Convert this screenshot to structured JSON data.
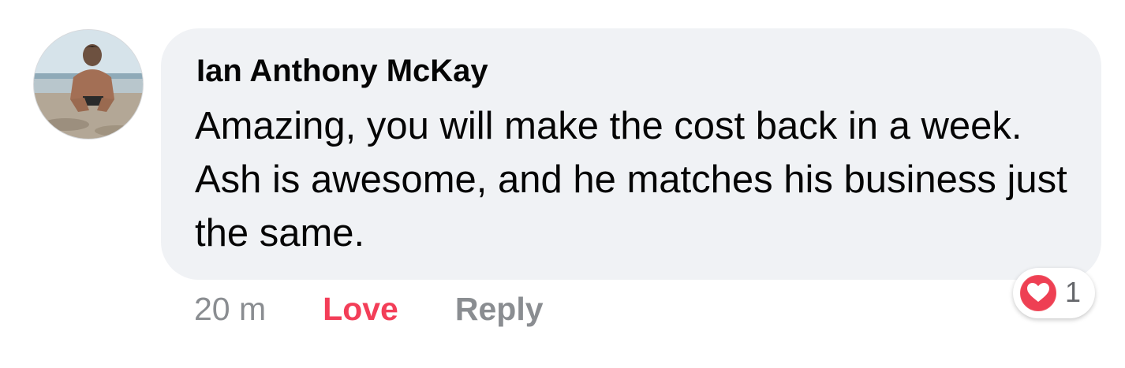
{
  "comment": {
    "author": "Ian Anthony McKay",
    "text": "Amazing, you will make the cost back in a week. Ash is awesome, and he matches his business just the same.",
    "timestamp": "20 m",
    "actions": {
      "love": "Love",
      "reply": "Reply"
    },
    "reaction": {
      "icon": "heart-icon",
      "count": "1"
    }
  },
  "colors": {
    "bubble_bg": "#f0f2f5",
    "love": "#f33e58",
    "muted": "#8a8d91",
    "text": "#050505"
  }
}
